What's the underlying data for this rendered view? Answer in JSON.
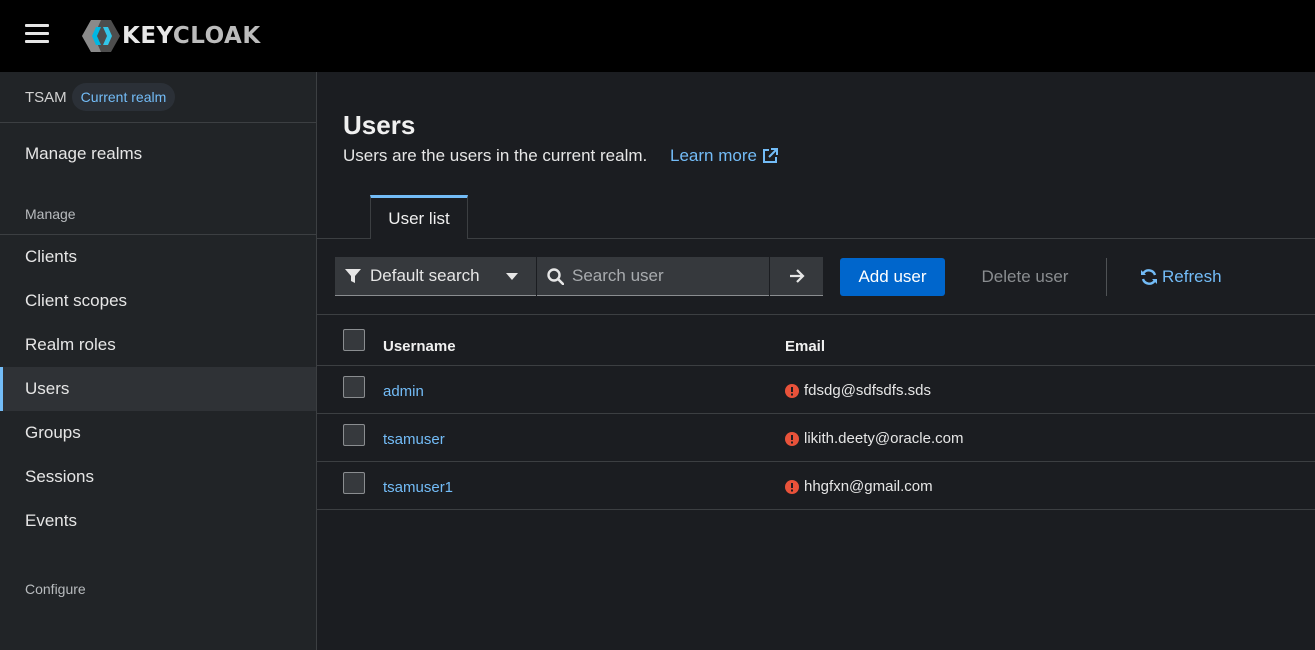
{
  "app": {
    "logo_text_key": "KEY",
    "logo_text_cloak": "CLOAK",
    "icons": {
      "menu": "hamburger-icon",
      "logo": "keycloak-logo-icon"
    }
  },
  "sidebar": {
    "realm_name": "TSAM",
    "realm_badge": "Current realm",
    "manage_realms": "Manage realms",
    "manage_section": "Manage",
    "items": [
      {
        "label": "Clients",
        "active": false
      },
      {
        "label": "Client scopes",
        "active": false
      },
      {
        "label": "Realm roles",
        "active": false
      },
      {
        "label": "Users",
        "active": true
      },
      {
        "label": "Groups",
        "active": false
      },
      {
        "label": "Sessions",
        "active": false
      },
      {
        "label": "Events",
        "active": false
      }
    ],
    "configure_section": "Configure"
  },
  "main": {
    "title": "Users",
    "description": "Users are the users in the current realm.",
    "learn_more": "Learn more",
    "tabs": [
      {
        "label": "User list",
        "active": true
      }
    ]
  },
  "toolbar": {
    "filter_label": "Default search",
    "search_placeholder": "Search user",
    "search_value": "",
    "add_user": "Add user",
    "delete_user": "Delete user",
    "refresh": "Refresh"
  },
  "table": {
    "columns": [
      "Username",
      "Email"
    ],
    "rows": [
      {
        "username": "admin",
        "email": "fdsdg@sdfsdfs.sds",
        "email_unverified": true
      },
      {
        "username": "tsamuser",
        "email": "likith.deety@oracle.com",
        "email_unverified": true
      },
      {
        "username": "tsamuser1",
        "email": "hhgfxn@gmail.com",
        "email_unverified": true
      }
    ]
  },
  "colors": {
    "accent": "#73bcf7",
    "primary_button": "#0066cc",
    "warning_icon": "#f0ab00",
    "danger_icon": "#e8523a",
    "background": "#1b1d21",
    "sidebar": "#212427",
    "topbar": "#000000"
  }
}
